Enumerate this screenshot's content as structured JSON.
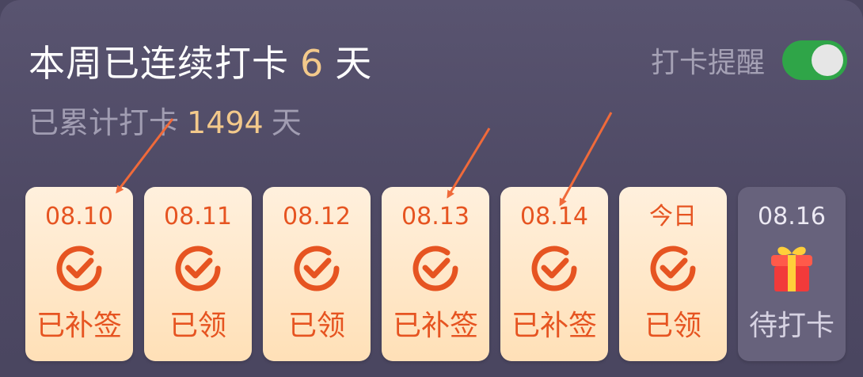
{
  "streak": {
    "prefix": "本周已连续打卡",
    "count": "6",
    "suffix": "天"
  },
  "total": {
    "prefix": "已累计打卡",
    "count": "1494",
    "suffix": "天"
  },
  "reminder": {
    "label": "打卡提醒",
    "enabled": true
  },
  "days": [
    {
      "date": "08.10",
      "status": "已补签",
      "state": "done",
      "icon": "check-circle-icon"
    },
    {
      "date": "08.11",
      "status": "已领",
      "state": "done",
      "icon": "check-circle-icon"
    },
    {
      "date": "08.12",
      "status": "已领",
      "state": "done",
      "icon": "check-circle-icon"
    },
    {
      "date": "08.13",
      "status": "已补签",
      "state": "done",
      "icon": "check-circle-icon"
    },
    {
      "date": "08.14",
      "status": "已补签",
      "state": "done",
      "icon": "check-circle-icon"
    },
    {
      "date": "今日",
      "status": "已领",
      "state": "done",
      "icon": "check-circle-icon"
    },
    {
      "date": "08.16",
      "status": "待打卡",
      "state": "pending",
      "icon": "gift-icon"
    }
  ],
  "colors": {
    "accent": "#e65421",
    "highlight": "#f3c98b",
    "toggle_on": "#2fa548",
    "annotation_arrow": "#f06a3a"
  }
}
